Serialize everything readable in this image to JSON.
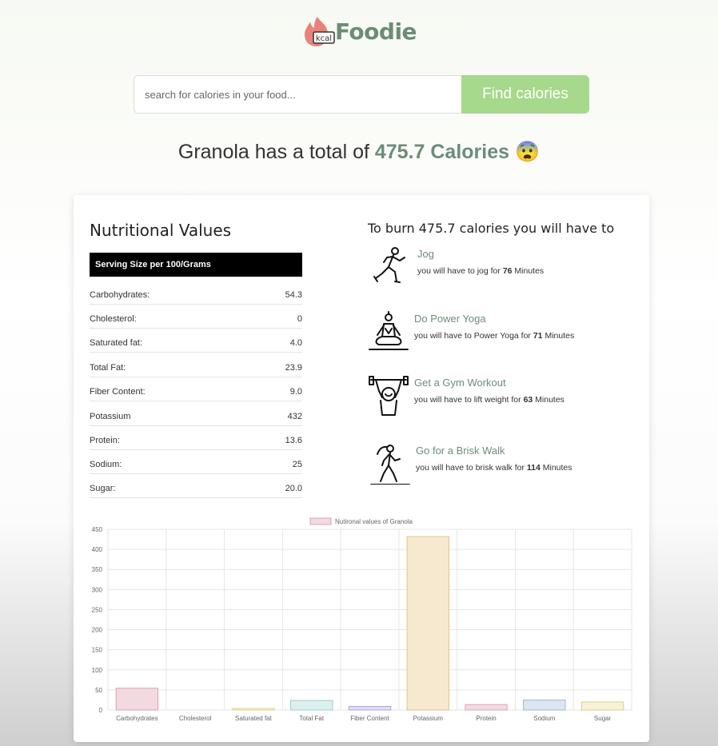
{
  "logo": {
    "badge": "kcal",
    "brand": "Foodie"
  },
  "search": {
    "placeholder": "search for calories in your food...",
    "button": "Find calories"
  },
  "result": {
    "prefix": "Granola has a total of ",
    "calories": "475.7 Calories",
    "emoji": "😨"
  },
  "nutrition": {
    "title": "Nutritional Values",
    "serving": "Serving Size per 100/Grams",
    "rows": [
      {
        "label": "Carbohydrates:",
        "value": "54.3"
      },
      {
        "label": "Cholesterol:",
        "value": "0"
      },
      {
        "label": "Saturated fat:",
        "value": "4.0"
      },
      {
        "label": "Total Fat:",
        "value": "23.9"
      },
      {
        "label": "Fiber Content:",
        "value": "9.0"
      },
      {
        "label": "Potassium",
        "value": "432"
      },
      {
        "label": "Protein:",
        "value": "13.6"
      },
      {
        "label": "Sodium:",
        "value": "25"
      },
      {
        "label": "Sugar:",
        "value": "20.0"
      }
    ]
  },
  "burn": {
    "title": "To burn 475.7 calories you will have to",
    "activities": [
      {
        "name": "Jog",
        "pre": "you will have to jog for ",
        "minutes": "76",
        "post": " Minutes",
        "icon": "jogging-icon"
      },
      {
        "name": "Do Power Yoga",
        "pre": "you will have to Power Yoga for ",
        "minutes": "71",
        "post": " Minutes",
        "icon": "yoga-icon"
      },
      {
        "name": "Get a Gym Workout",
        "pre": "you will have to lift weight for ",
        "minutes": "63",
        "post": " Minutes",
        "icon": "weightlifting-icon"
      },
      {
        "name": "Go for a Brisk Walk",
        "pre": "you will have to brisk walk for ",
        "minutes": "114",
        "post": " Minutes",
        "icon": "walking-icon"
      }
    ]
  },
  "chart_data": {
    "type": "bar",
    "legend": "Nutironal values of Granola",
    "categories": [
      "Carbohydrates",
      "Cholesterol",
      "Saturated fat",
      "Total Fat",
      "Fiber Content",
      "Potassium",
      "Protein",
      "Sodium",
      "Sugar"
    ],
    "values": [
      54.3,
      0,
      4.0,
      23.9,
      9.0,
      432,
      13.6,
      25,
      20.0
    ],
    "ylim": [
      0,
      450
    ],
    "yticks": [
      0,
      50,
      100,
      150,
      200,
      250,
      300,
      350,
      400,
      450
    ],
    "grid": true,
    "legend_position": "top",
    "fill_colors": [
      "#f3d9e0",
      "#fbe7d6",
      "#faf1d6",
      "#dcefef",
      "#e3dcf7",
      "#f7e9d0",
      "#f3d9e0",
      "#dbe6f3",
      "#f7f2d7"
    ],
    "stroke_colors": [
      "#d8a4b4",
      "#e8b99a",
      "#e3cf8f",
      "#9fcccc",
      "#b0a2e0",
      "#e2c38f",
      "#d8a4b4",
      "#9fb8d8",
      "#d9cd8c"
    ]
  },
  "colors": {
    "accent": "#6b8d78",
    "button": "#a6d98b"
  }
}
